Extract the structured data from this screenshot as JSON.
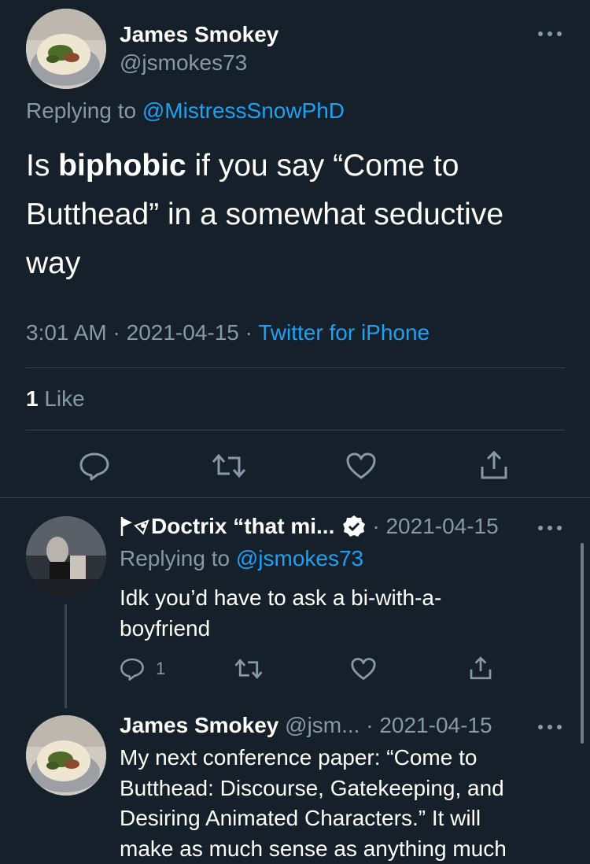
{
  "main_tweet": {
    "author_name": "James Smokey",
    "author_handle": "@jsmokes73",
    "replying_prefix": "Replying to",
    "replying_to": "@MistressSnowPhD",
    "text_part1": "Is ",
    "text_bold": "biphobic",
    "text_line1_rest": " if you say “Come to",
    "text_line2": "Butthead” in a somewhat seductive",
    "text_line3": "way",
    "time": "3:01 AM",
    "sep": "·",
    "date": "2021-04-15",
    "source": "Twitter for iPhone",
    "likes_count": "1",
    "likes_label": "Like"
  },
  "reply1": {
    "author_name": "Doctrix “that mi...",
    "sep_date": "· 2021-04-15",
    "replying_prefix": "Replying to",
    "replying_to": "@jsmokes73",
    "text_line1": "Idk you’d have to ask a bi-with-a-",
    "text_line2": "boyfriend",
    "reply_count": "1"
  },
  "reply2": {
    "author_name": "James Smokey",
    "author_handle": "@jsm...",
    "sep_date": "· 2021-04-15",
    "text_line1": "My next conference paper: “Come to",
    "text_line2": "Butthead: Discourse, Gatekeeping, and",
    "text_line3": "Desiring Animated Characters.” It  will",
    "text_line4": "make as much sense as anything much"
  },
  "icons": {
    "more": "more-horizontal-icon",
    "reply": "reply-icon",
    "retweet": "retweet-icon",
    "like": "heart-icon",
    "share": "share-icon",
    "verified": "verified-badge-icon"
  },
  "colors": {
    "background": "#15202b",
    "muted": "#8899a6",
    "link": "#1da1f2",
    "divider": "#38444d"
  }
}
